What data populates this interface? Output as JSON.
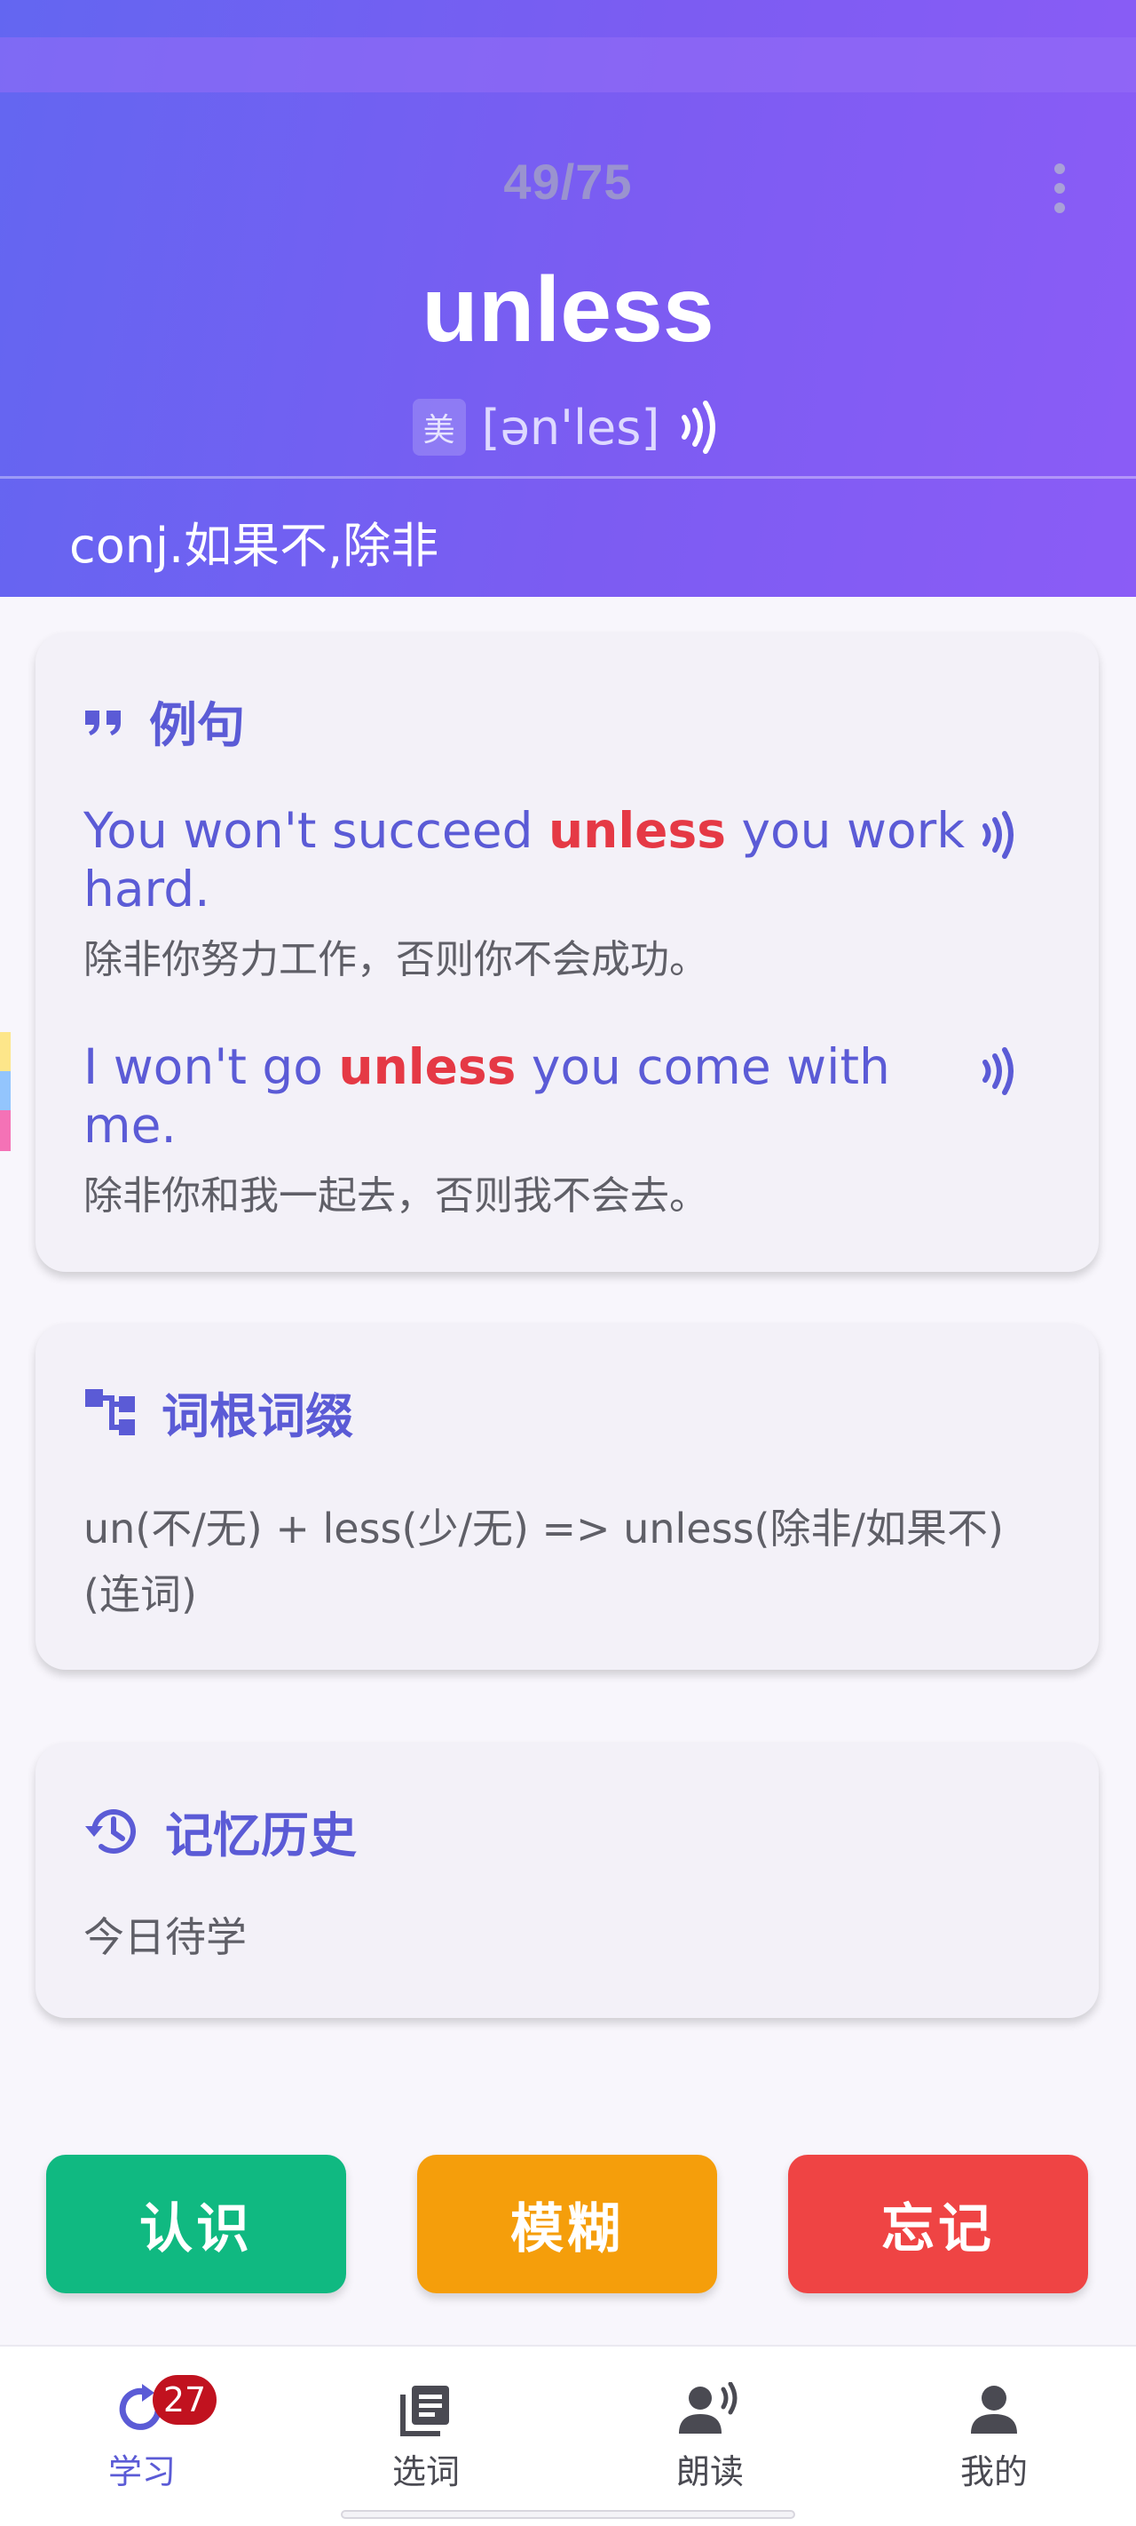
{
  "header": {
    "progress": "49/75",
    "word": "unless",
    "region": "美",
    "phonetic": "[ən'les]",
    "definition": "conj.如果不,除非"
  },
  "examples_card": {
    "title": "例句",
    "items": [
      {
        "before": "You won't succeed ",
        "highlight": "unless",
        "after": " you work hard.",
        "translation": "除非你努力工作，否则你不会成功。"
      },
      {
        "before": "I won't go ",
        "highlight": "unless",
        "after": " you come with me.",
        "translation": "除非你和我一起去，否则我不会去。"
      }
    ]
  },
  "root_card": {
    "title": "词根词缀",
    "text": "un(不/无) + less(少/无) => unless(除非/如果不)(连词)"
  },
  "history_card": {
    "title": "记忆历史",
    "text": "今日待学"
  },
  "actions": {
    "know": "认识",
    "fuzzy": "模糊",
    "forget": "忘记"
  },
  "nav": {
    "study": "学习",
    "study_badge": "27",
    "select": "选词",
    "read": "朗读",
    "mine": "我的"
  },
  "colors": {
    "accent": "#5b5bd6",
    "highlight": "#e53945",
    "know": "#10b981",
    "fuzzy": "#f59e0b",
    "forget": "#ef4444"
  },
  "icons": {
    "menu": "more-vertical-icon",
    "speaker": "speaker-icon",
    "quote": "quote-icon",
    "root": "tree-structure-icon",
    "history": "history-icon",
    "study": "refresh-icon",
    "select": "book-list-icon",
    "read": "voice-user-icon",
    "mine": "person-icon"
  }
}
